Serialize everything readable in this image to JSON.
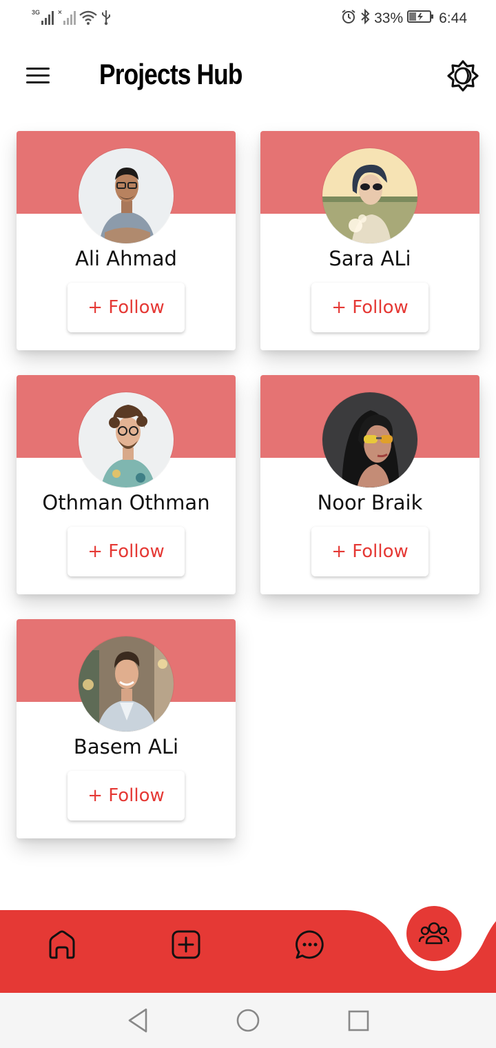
{
  "status_bar": {
    "network_left": "3G",
    "battery": "33%",
    "time": "6:44",
    "icons": [
      "signal-3g-icon",
      "signal-x-icon",
      "wifi-icon",
      "usb-icon",
      "alarm-icon",
      "bluetooth-icon",
      "battery-charging-icon"
    ]
  },
  "header": {
    "title": "Projects Hub",
    "menu_icon": "hamburger-menu-icon",
    "theme_icon": "brightness-theme-icon"
  },
  "colors": {
    "accent": "#e53935",
    "card_band": "#e57373",
    "text": "#111111",
    "background": "#ffffff"
  },
  "users": [
    {
      "name": "Ali Ahmad",
      "follow_label": "+ Follow"
    },
    {
      "name": "Sara ALi",
      "follow_label": "+ Follow"
    },
    {
      "name": "Othman Othman",
      "follow_label": "+ Follow"
    },
    {
      "name": "Noor Braik",
      "follow_label": "+ Follow"
    },
    {
      "name": "Basem ALi",
      "follow_label": "+ Follow"
    }
  ],
  "bottom_nav": {
    "items": [
      "home-icon",
      "add-square-icon",
      "chat-icon"
    ],
    "active": "users-group-icon"
  },
  "system_nav": [
    "back-icon",
    "home-circle-icon",
    "recents-icon"
  ]
}
